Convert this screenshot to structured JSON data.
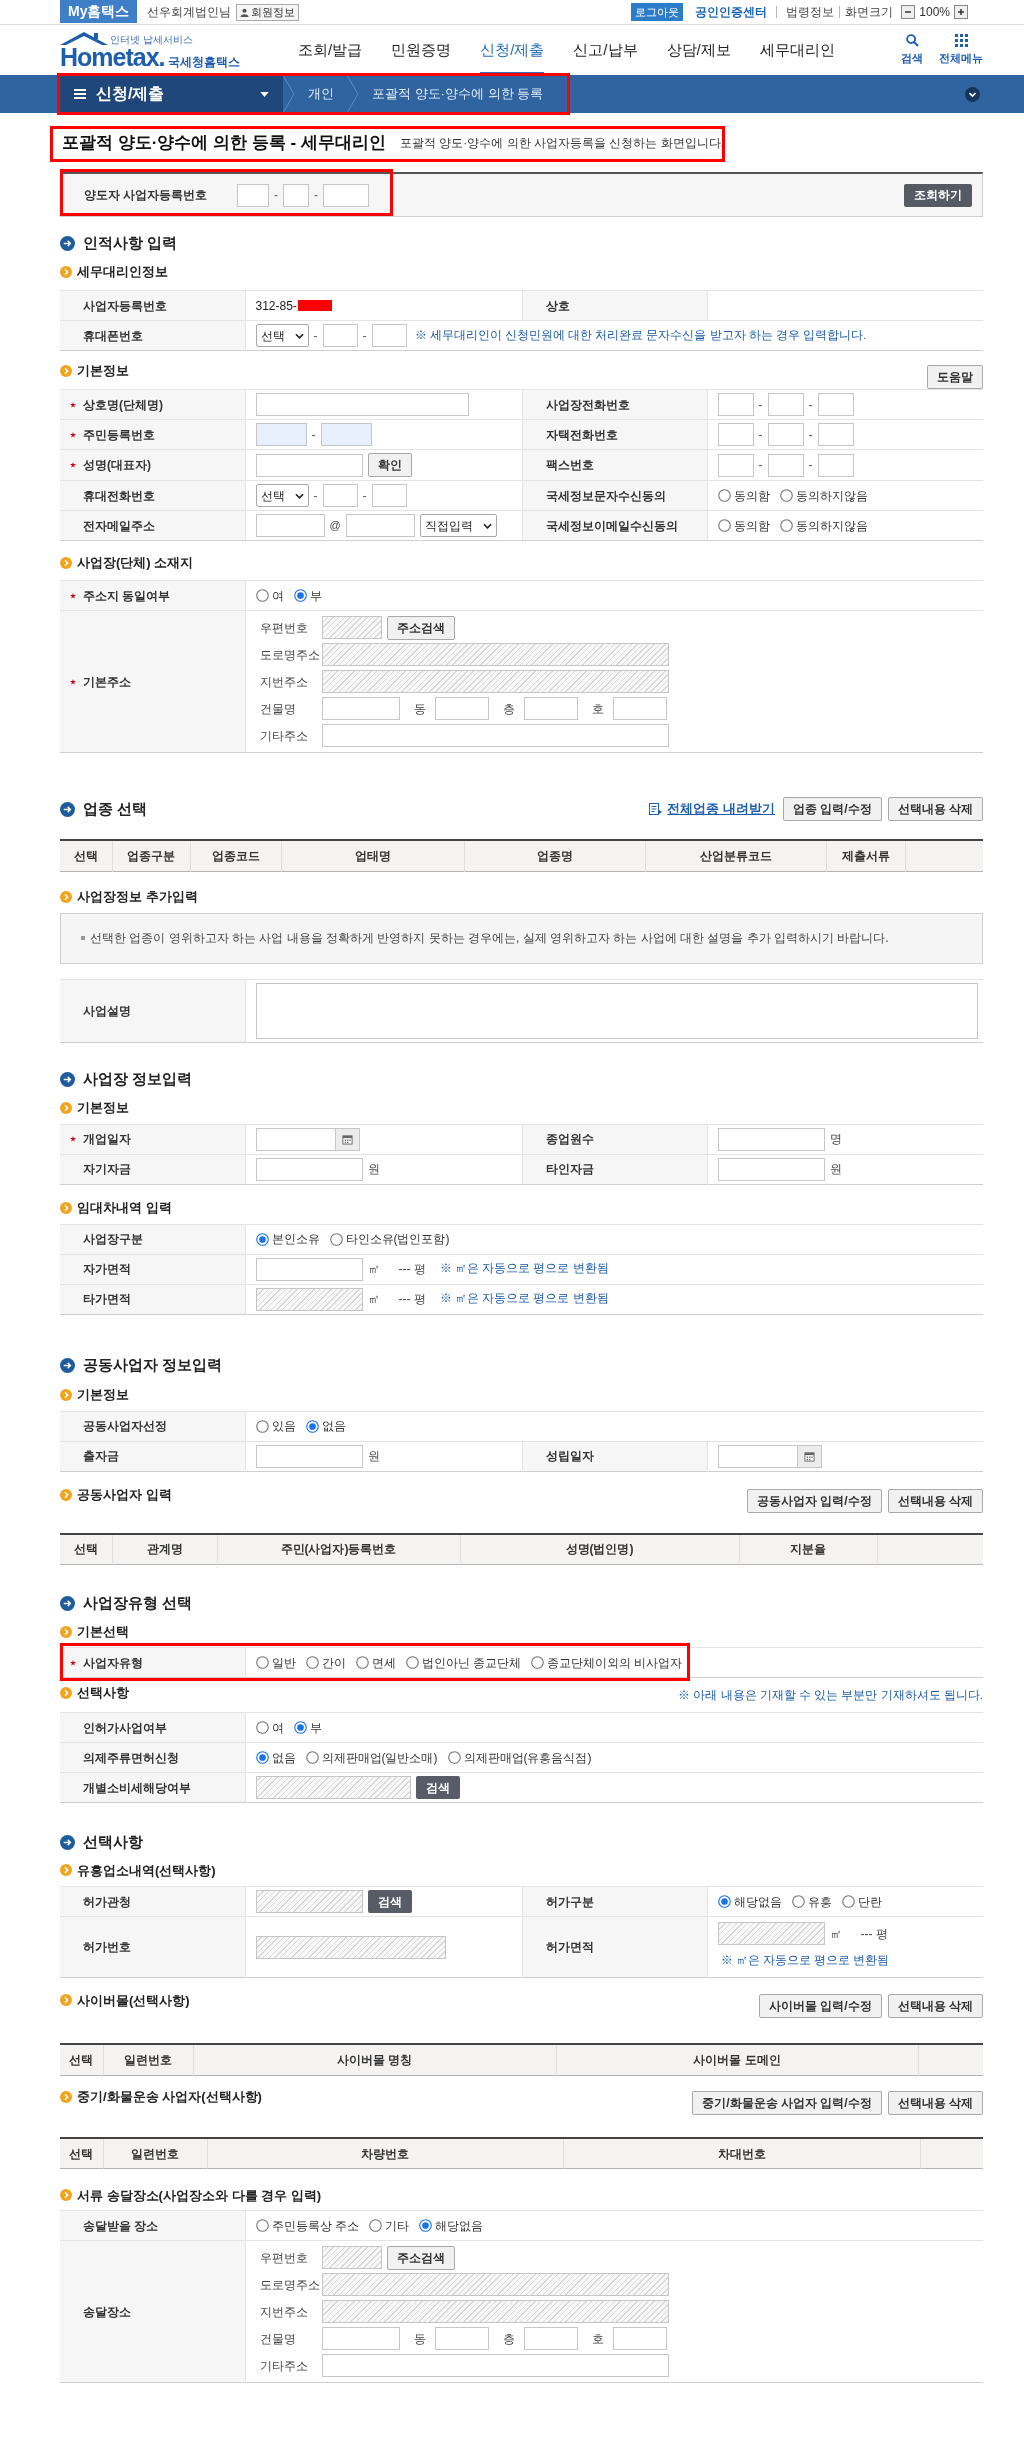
{
  "top_bar": {
    "my_home": "My홈택스",
    "user_name": "선우회계법인님",
    "member_info": "회원정보",
    "logout": "로그아웃",
    "cert_center": "공인인증센터",
    "links": [
      "법령정보"
    ],
    "zoom_label": "화면크기",
    "zoom_level": "100%"
  },
  "header": {
    "logo": {
      "tagline": "인터넷 납세서비스",
      "brand": "Hometax.",
      "name": "국세청홈택스"
    },
    "nav": [
      {
        "label": "조회/발급",
        "selected": false
      },
      {
        "label": "민원증명",
        "selected": false
      },
      {
        "label": "신청/제출",
        "selected": true
      },
      {
        "label": "신고/납부",
        "selected": false
      },
      {
        "label": "상담/제보",
        "selected": false
      },
      {
        "label": "세무대리인",
        "selected": false
      }
    ],
    "tools": [
      {
        "kind": "search",
        "label": "검색"
      },
      {
        "kind": "menu",
        "label": "전체메뉴"
      }
    ]
  },
  "breadcrumb": {
    "highlighted": true,
    "menu": "신청/제출",
    "items": [
      "개인",
      "포괄적 양도·양수에 의한 등록"
    ]
  },
  "page": {
    "highlighted": true,
    "title": "포괄적 양도·양수에 의한 등록 - 세무대리인",
    "description": "포괄적 양도·양수에 의한 사업자등록을 신청하는 화면입니다."
  },
  "lookup": {
    "highlighted": true,
    "label": "양도자 사업자등록번호",
    "controls": [
      {
        "kind": "bizno1",
        "disabled": false
      },
      {
        "kind": "dash",
        "text": "-"
      },
      {
        "kind": "bizno2",
        "disabled": false
      },
      {
        "kind": "dash",
        "text": "-"
      },
      {
        "kind": "bizno3",
        "disabled": false
      }
    ],
    "button": "조회하기"
  },
  "blocks": [
    {
      "kind": "heading",
      "text": "인적사항 입력"
    },
    {
      "kind": "subheading",
      "text": "세무대리인정보"
    },
    {
      "kind": "form",
      "rows": [
        {
          "cells": [
            {
              "kind": "label",
              "label": "사업자등록번호",
              "required": false
            },
            {
              "kind": "value",
              "controls": [
                {
                  "kind": "text",
                  "text": "312-85-"
                },
                {
                  "kind": "redaction"
                }
              ]
            },
            {
              "kind": "label",
              "label": "상호",
              "required": false
            },
            {
              "kind": "empty"
            }
          ]
        },
        {
          "cells": [
            {
              "kind": "label",
              "label": "휴대폰번호",
              "required": false
            },
            {
              "kind": "value",
              "colspan": 3,
              "controls": [
                {
                  "kind": "select",
                  "value": "선택"
                },
                {
                  "kind": "dash",
                  "text": "-"
                },
                {
                  "kind": "phone",
                  "disabled": false
                },
                {
                  "kind": "dash",
                  "text": "-"
                },
                {
                  "kind": "phone",
                  "disabled": false
                },
                {
                  "kind": "note",
                  "text": "※ 세무대리인이 신청민원에 대한 처리완료 문자수신을 받고자 하는 경우 입력합니다."
                }
              ]
            }
          ]
        }
      ]
    },
    {
      "kind": "subheading",
      "text": "기본정보",
      "actions": [
        {
          "kind": "button",
          "label": "도움말"
        }
      ]
    },
    {
      "kind": "form",
      "rows": [
        {
          "cells": [
            {
              "kind": "label",
              "label": "상호명(단체명)",
              "required": true
            },
            {
              "kind": "value",
              "controls": [
                {
                  "kind": "name",
                  "disabled": false
                }
              ]
            },
            {
              "kind": "label",
              "label": "사업장전화번호",
              "required": false
            },
            {
              "kind": "value",
              "controls": [
                {
                  "kind": "tel",
                  "disabled": false
                },
                {
                  "kind": "dash",
                  "text": "-"
                },
                {
                  "kind": "tel",
                  "disabled": false
                },
                {
                  "kind": "dash",
                  "text": "-"
                },
                {
                  "kind": "tel",
                  "disabled": false
                }
              ]
            }
          ]
        },
        {
          "cells": [
            {
              "kind": "label",
              "label": "주민등록번호",
              "required": true
            },
            {
              "kind": "value",
              "controls": [
                {
                  "kind": "rrn",
                  "disabled": false
                },
                {
                  "kind": "dash",
                  "text": "-"
                },
                {
                  "kind": "rrn",
                  "disabled": false
                }
              ]
            },
            {
              "kind": "label",
              "label": "자택전화번호",
              "required": false
            },
            {
              "kind": "value",
              "controls": [
                {
                  "kind": "tel",
                  "disabled": false
                },
                {
                  "kind": "dash",
                  "text": "-"
                },
                {
                  "kind": "tel",
                  "disabled": false
                },
                {
                  "kind": "dash",
                  "text": "-"
                },
                {
                  "kind": "tel",
                  "disabled": false
                }
              ]
            }
          ]
        },
        {
          "cells": [
            {
              "kind": "label",
              "label": "성명(대표자)",
              "required": true
            },
            {
              "kind": "value",
              "controls": [
                {
                  "kind": "person",
                  "disabled": false
                },
                {
                  "kind": "button",
                  "label": "확인"
                }
              ]
            },
            {
              "kind": "label",
              "label": "팩스번호",
              "required": false
            },
            {
              "kind": "value",
              "controls": [
                {
                  "kind": "tel",
                  "disabled": false
                },
                {
                  "kind": "dash",
                  "text": "-"
                },
                {
                  "kind": "tel",
                  "disabled": false
                },
                {
                  "kind": "dash",
                  "text": "-"
                },
                {
                  "kind": "tel",
                  "disabled": false
                }
              ]
            }
          ]
        },
        {
          "cells": [
            {
              "kind": "label",
              "label": "휴대전화번호",
              "required": false
            },
            {
              "kind": "value",
              "controls": [
                {
                  "kind": "select",
                  "value": "선택"
                },
                {
                  "kind": "dash",
                  "text": "-"
                },
                {
                  "kind": "phone",
                  "disabled": false
                },
                {
                  "kind": "dash",
                  "text": "-"
                },
                {
                  "kind": "phone",
                  "disabled": false
                }
              ]
            },
            {
              "kind": "label",
              "label": "국세정보문자수신동의",
              "required": false
            },
            {
              "kind": "value",
              "controls": [
                {
                  "kind": "radio",
                  "label": "동의함",
                  "selected": false
                },
                {
                  "kind": "radio",
                  "label": "동의하지않음",
                  "selected": false
                }
              ]
            }
          ]
        },
        {
          "cells": [
            {
              "kind": "label",
              "label": "전자메일주소",
              "required": false
            },
            {
              "kind": "value",
              "controls": [
                {
                  "kind": "email",
                  "disabled": false
                },
                {
                  "kind": "at",
                  "text": "@"
                },
                {
                  "kind": "email",
                  "disabled": false
                },
                {
                  "kind": "domainselect",
                  "value": "직접입력"
                }
              ]
            },
            {
              "kind": "label",
              "label": "국세정보이메일수신동의",
              "required": false
            },
            {
              "kind": "value",
              "controls": [
                {
                  "kind": "radio",
                  "label": "동의함",
                  "selected": false
                },
                {
                  "kind": "radio",
                  "label": "동의하지않음",
                  "selected": false
                }
              ]
            }
          ]
        }
      ]
    },
    {
      "kind": "subheading",
      "text": "사업장(단체) 소재지"
    },
    {
      "kind": "form",
      "rows": [
        {
          "cells": [
            {
              "kind": "label",
              "label": "주소지 동일여부",
              "required": true
            },
            {
              "kind": "value",
              "controls": [
                {
                  "kind": "radio",
                  "label": "여",
                  "selected": false
                },
                {
                  "kind": "radio",
                  "label": "부",
                  "selected": true
                }
              ]
            }
          ]
        },
        {
          "cells": [
            {
              "kind": "label",
              "label": "기본주소",
              "required": true
            },
            {
              "kind": "value",
              "lines": [
                {
                  "label": "우편번호",
                  "controls": [
                    {
                      "kind": "zip",
                      "disabled": true
                    },
                    {
                      "kind": "button",
                      "label": "주소검색"
                    }
                  ]
                },
                {
                  "label": "도로명주소",
                  "controls": [
                    {
                      "kind": "address",
                      "disabled": true
                    }
                  ]
                },
                {
                  "label": "지번주소",
                  "controls": [
                    {
                      "kind": "address",
                      "disabled": true
                    }
                  ]
                },
                {
                  "label": "건물명",
                  "controls": [
                    {
                      "kind": "building",
                      "disabled": false
                    },
                    {
                      "kind": "infix",
                      "text": "동"
                    },
                    {
                      "kind": "unitno",
                      "disabled": false
                    },
                    {
                      "kind": "infix",
                      "text": "층"
                    },
                    {
                      "kind": "unitno",
                      "disabled": false
                    },
                    {
                      "kind": "infix",
                      "text": "호"
                    },
                    {
                      "kind": "unitno",
                      "disabled": false
                    }
                  ]
                },
                {
                  "label": "기타주소",
                  "controls": [
                    {
                      "kind": "address",
                      "disabled": false
                    }
                  ]
                }
              ]
            }
          ]
        }
      ]
    },
    {
      "kind": "heading",
      "text": "업종 선택",
      "actions": [
        {
          "kind": "link",
          "label": "전체업종 내려받기"
        },
        {
          "kind": "button",
          "label": "업종 입력/수정"
        },
        {
          "kind": "button",
          "label": "선택내용 삭제"
        }
      ]
    },
    {
      "kind": "list",
      "columns": [
        "선택",
        "업종구분",
        "업종코드",
        "업태명",
        "업종명",
        "산업분류코드",
        "제출서류"
      ]
    },
    {
      "kind": "subheading",
      "text": "사업장정보 추가입력"
    },
    {
      "kind": "notice",
      "text": "선택한 업종이 영위하고자 하는 사업 내용을 정확하게 반영하지 못하는 경우에는, 실제 영위하고자 하는 사업에 대한 설명을 추가 입력하시기 바랍니다."
    },
    {
      "kind": "form",
      "rows": [
        {
          "cells": [
            {
              "kind": "label",
              "label": "사업설명",
              "required": false
            },
            {
              "kind": "value",
              "controls": [
                {
                  "kind": "description",
                  "disabled": false
                }
              ]
            }
          ]
        }
      ]
    },
    {
      "kind": "heading",
      "text": "사업장 정보입력"
    },
    {
      "kind": "subheading",
      "text": "기본정보"
    },
    {
      "kind": "form",
      "rows": [
        {
          "cells": [
            {
              "kind": "label",
              "label": "개업일자",
              "required": true
            },
            {
              "kind": "value",
              "controls": [
                {
                  "kind": "date"
                }
              ]
            },
            {
              "kind": "label",
              "label": "종업원수",
              "required": false
            },
            {
              "kind": "value",
              "controls": [
                {
                  "kind": "count",
                  "disabled": false
                },
                {
                  "kind": "unit",
                  "text": "명"
                }
              ]
            }
          ]
        },
        {
          "cells": [
            {
              "kind": "label",
              "label": "자기자금",
              "required": false
            },
            {
              "kind": "value",
              "controls": [
                {
                  "kind": "amount",
                  "disabled": false
                },
                {
                  "kind": "unit",
                  "text": "원"
                }
              ]
            },
            {
              "kind": "label",
              "label": "타인자금",
              "required": false
            },
            {
              "kind": "value",
              "controls": [
                {
                  "kind": "count",
                  "disabled": false
                },
                {
                  "kind": "unit",
                  "text": "원"
                }
              ]
            }
          ]
        }
      ]
    },
    {
      "kind": "subheading",
      "text": "임대차내역 입력"
    },
    {
      "kind": "form",
      "rows": [
        {
          "cells": [
            {
              "kind": "label",
              "label": "사업장구분",
              "required": false
            },
            {
              "kind": "value",
              "controls": [
                {
                  "kind": "radio",
                  "label": "본인소유",
                  "selected": true
                },
                {
                  "kind": "radio",
                  "label": "타인소유(법인포함)",
                  "selected": false
                }
              ]
            }
          ]
        },
        {
          "cells": [
            {
              "kind": "label",
              "label": "자가면적",
              "required": false
            },
            {
              "kind": "value",
              "controls": [
                {
                  "kind": "area",
                  "disabled": false
                },
                {
                  "kind": "unit",
                  "text": "㎡"
                },
                {
                  "kind": "reading",
                  "text": "--- 평"
                },
                {
                  "kind": "note",
                  "text": "※ ㎡은 자동으로 평으로 변환됨"
                }
              ]
            }
          ]
        },
        {
          "cells": [
            {
              "kind": "label",
              "label": "타가면적",
              "required": false
            },
            {
              "kind": "value",
              "controls": [
                {
                  "kind": "area",
                  "disabled": true
                },
                {
                  "kind": "unit",
                  "text": "㎡"
                },
                {
                  "kind": "reading",
                  "text": "--- 평"
                },
                {
                  "kind": "note",
                  "text": "※ ㎡은 자동으로 평으로 변환됨"
                }
              ]
            }
          ]
        }
      ]
    },
    {
      "kind": "heading",
      "text": "공동사업자 정보입력"
    },
    {
      "kind": "subheading",
      "text": "기본정보"
    },
    {
      "kind": "form",
      "rows": [
        {
          "cells": [
            {
              "kind": "label",
              "label": "공동사업자선정",
              "required": false
            },
            {
              "kind": "value",
              "colspan": 3,
              "controls": [
                {
                  "kind": "radio",
                  "label": "있음",
                  "selected": false
                },
                {
                  "kind": "radio",
                  "label": "없음",
                  "selected": true
                }
              ]
            }
          ]
        },
        {
          "cells": [
            {
              "kind": "label",
              "label": "출자금",
              "required": false
            },
            {
              "kind": "value",
              "controls": [
                {
                  "kind": "amount",
                  "disabled": false
                },
                {
                  "kind": "unit",
                  "text": "원"
                }
              ]
            },
            {
              "kind": "label",
              "label": "성립일자",
              "required": false
            },
            {
              "kind": "value",
              "controls": [
                {
                  "kind": "date"
                }
              ]
            }
          ]
        }
      ]
    },
    {
      "kind": "subheading",
      "text": "공동사업자 입력",
      "actions": [
        {
          "kind": "button",
          "label": "공동사업자 입력/수정"
        },
        {
          "kind": "button",
          "label": "선택내용 삭제"
        }
      ]
    },
    {
      "kind": "list",
      "columns": [
        "선택",
        "관계명",
        "주민(사업자)등록번호",
        "성명(법인명)",
        "지분율"
      ]
    },
    {
      "kind": "heading",
      "text": "사업장유형 선택"
    },
    {
      "kind": "subheading",
      "text": "기본선택"
    },
    {
      "kind": "form",
      "highlighted": true,
      "rows": [
        {
          "cells": [
            {
              "kind": "label",
              "label": "사업자유형",
              "required": true
            },
            {
              "kind": "value",
              "controls": [
                {
                  "kind": "radio",
                  "label": "일반",
                  "selected": false
                },
                {
                  "kind": "radio",
                  "label": "간이",
                  "selected": false
                },
                {
                  "kind": "radio",
                  "label": "면세",
                  "selected": false
                },
                {
                  "kind": "radio",
                  "label": "법인아닌 종교단체",
                  "selected": false
                },
                {
                  "kind": "radio",
                  "label": "종교단체이외의 비사업자",
                  "selected": false
                }
              ]
            }
          ]
        }
      ]
    },
    {
      "kind": "subheading",
      "text": "선택사항",
      "note": "※ 아래 내용은 기재할 수 있는 부분만 기재하셔도 됩니다."
    },
    {
      "kind": "form",
      "rows": [
        {
          "cells": [
            {
              "kind": "label",
              "label": "인허가사업여부",
              "required": false
            },
            {
              "kind": "value",
              "controls": [
                {
                  "kind": "radio",
                  "label": "여",
                  "selected": false
                },
                {
                  "kind": "radio",
                  "label": "부",
                  "selected": true
                }
              ]
            }
          ]
        },
        {
          "cells": [
            {
              "kind": "label",
              "label": "의제주류면허신청",
              "required": false
            },
            {
              "kind": "value",
              "controls": [
                {
                  "kind": "radio",
                  "label": "없음",
                  "selected": true
                },
                {
                  "kind": "radio",
                  "label": "의제판매업(일반소매)",
                  "selected": false
                },
                {
                  "kind": "radio",
                  "label": "의제판매업(유흥음식점)",
                  "selected": false
                }
              ]
            }
          ]
        },
        {
          "cells": [
            {
              "kind": "label",
              "label": "개별소비세해당여부",
              "required": false
            },
            {
              "kind": "value",
              "controls": [
                {
                  "kind": "code",
                  "disabled": true
                },
                {
                  "kind": "dark_button",
                  "label": "검색"
                }
              ]
            }
          ]
        }
      ]
    },
    {
      "kind": "heading",
      "text": "선택사항"
    },
    {
      "kind": "subheading",
      "text": "유흥업소내역(선택사항)"
    },
    {
      "kind": "form",
      "rows": [
        {
          "cells": [
            {
              "kind": "label",
              "label": "허가관청",
              "required": false
            },
            {
              "kind": "value",
              "controls": [
                {
                  "kind": "office",
                  "disabled": true
                },
                {
                  "kind": "dark_button",
                  "label": "검색"
                }
              ]
            },
            {
              "kind": "label",
              "label": "허가구분",
              "required": false
            },
            {
              "kind": "value",
              "controls": [
                {
                  "kind": "radio",
                  "label": "해당없음",
                  "selected": true
                },
                {
                  "kind": "radio",
                  "label": "유흥",
                  "selected": false
                },
                {
                  "kind": "radio",
                  "label": "단란",
                  "selected": false
                }
              ]
            }
          ]
        },
        {
          "cells": [
            {
              "kind": "label",
              "label": "허가번호",
              "required": false
            },
            {
              "kind": "value",
              "controls": [
                {
                  "kind": "permit",
                  "disabled": true
                }
              ]
            },
            {
              "kind": "label",
              "label": "허가면적",
              "required": false
            },
            {
              "kind": "value",
              "lines": [
                {
                  "controls": [
                    {
                      "kind": "area",
                      "disabled": true
                    },
                    {
                      "kind": "unit",
                      "text": "㎡"
                    },
                    {
                      "kind": "reading",
                      "text": "--- 평"
                    }
                  ]
                },
                {
                  "controls": [
                    {
                      "kind": "note",
                      "text": "※ ㎡은 자동으로 평으로 변환됨"
                    }
                  ]
                }
              ]
            }
          ]
        }
      ]
    },
    {
      "kind": "subheading",
      "text": "사이버몰(선택사항)",
      "actions": [
        {
          "kind": "button",
          "label": "사이버몰 입력/수정"
        },
        {
          "kind": "button",
          "label": "선택내용 삭제"
        }
      ]
    },
    {
      "kind": "list",
      "columns": [
        "선택",
        "일련번호",
        "사이버몰 명칭",
        "사이버몰 도메인"
      ]
    },
    {
      "kind": "subheading",
      "text": "중기/화물운송 사업자(선택사항)",
      "actions": [
        {
          "kind": "button",
          "label": "중기/화물운송 사업자 입력/수정"
        },
        {
          "kind": "button",
          "label": "선택내용 삭제"
        }
      ]
    },
    {
      "kind": "list",
      "columns": [
        "선택",
        "일련번호",
        "차량번호",
        "차대번호"
      ]
    },
    {
      "kind": "subheading",
      "text": "서류 송달장소(사업장소와 다를 경우 입력)"
    },
    {
      "kind": "form",
      "rows": [
        {
          "cells": [
            {
              "kind": "label",
              "label": "송달받을 장소",
              "required": false
            },
            {
              "kind": "value",
              "controls": [
                {
                  "kind": "radio",
                  "label": "주민등록상 주소",
                  "selected": false
                },
                {
                  "kind": "radio",
                  "label": "기타",
                  "selected": false
                },
                {
                  "kind": "radio",
                  "label": "해당없음",
                  "selected": true
                }
              ]
            }
          ]
        },
        {
          "cells": [
            {
              "kind": "label",
              "label": "송달장소",
              "required": false
            },
            {
              "kind": "value",
              "lines": [
                {
                  "label": "우편번호",
                  "controls": [
                    {
                      "kind": "zip",
                      "disabled": true
                    },
                    {
                      "kind": "button",
                      "label": "주소검색"
                    }
                  ]
                },
                {
                  "label": "도로명주소",
                  "controls": [
                    {
                      "kind": "address",
                      "disabled": true
                    }
                  ]
                },
                {
                  "label": "지번주소",
                  "controls": [
                    {
                      "kind": "address",
                      "disabled": true
                    }
                  ]
                },
                {
                  "label": "건물명",
                  "controls": [
                    {
                      "kind": "building",
                      "disabled": false
                    },
                    {
                      "kind": "infix",
                      "text": "동"
                    },
                    {
                      "kind": "unitno",
                      "disabled": false
                    },
                    {
                      "kind": "infix",
                      "text": "층"
                    },
                    {
                      "kind": "unitno",
                      "disabled": false
                    },
                    {
                      "kind": "infix",
                      "text": "호"
                    },
                    {
                      "kind": "unitno",
                      "disabled": false
                    }
                  ]
                },
                {
                  "label": "기타주소",
                  "controls": [
                    {
                      "kind": "address",
                      "disabled": false
                    }
                  ]
                }
              ]
            }
          ]
        }
      ]
    }
  ]
}
